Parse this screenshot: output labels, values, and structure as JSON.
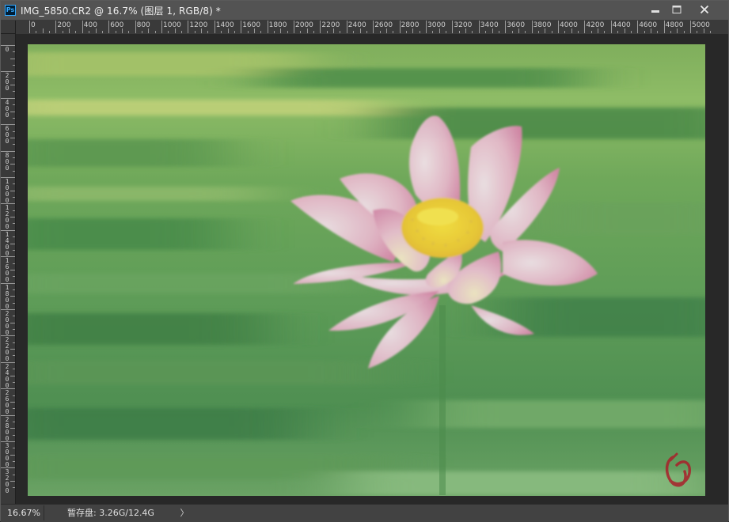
{
  "window": {
    "app_icon_text": "Ps",
    "title": "IMG_5850.CR2 @  16.7% (图层 1, RGB/8) *"
  },
  "controls": {
    "minimize_icon": "minimize-icon",
    "maximize_icon": "maximize-icon",
    "close_icon": "close-icon"
  },
  "ruler_h": {
    "labels": [
      "0",
      "200",
      "400",
      "600",
      "800",
      "1000",
      "1200",
      "1400",
      "1600",
      "1800",
      "2000",
      "2200",
      "2400",
      "2600",
      "2800",
      "3000",
      "3200",
      "3400",
      "3600",
      "3800",
      "4000",
      "4200",
      "4400",
      "4600",
      "4800",
      "5000"
    ]
  },
  "ruler_v": {
    "labels": [
      "0",
      "2\n0\n0",
      "4\n0\n0",
      "6\n0\n0",
      "8\n0\n0",
      "1\n0\n0\n0",
      "1\n2\n0\n0",
      "1\n4\n0\n0",
      "1\n6\n0\n0",
      "1\n8\n0\n0",
      "2\n0\n0\n0",
      "2\n2\n0\n0",
      "2\n4\n0\n0",
      "2\n6\n0\n0",
      "2\n8\n0\n0",
      "3\n0\n0\n0",
      "3\n2\n0\n0"
    ]
  },
  "status": {
    "zoom": "16.67%",
    "scratch_label": "暂存盘:",
    "scratch_value": "3.26G/12.4G",
    "arrow": "〉"
  },
  "colors": {
    "bg_green": "#5e9a56",
    "petal_pink": "#e6a9c4",
    "center_yellow": "#f2cf3a",
    "watermark_red": "#a8202a"
  }
}
